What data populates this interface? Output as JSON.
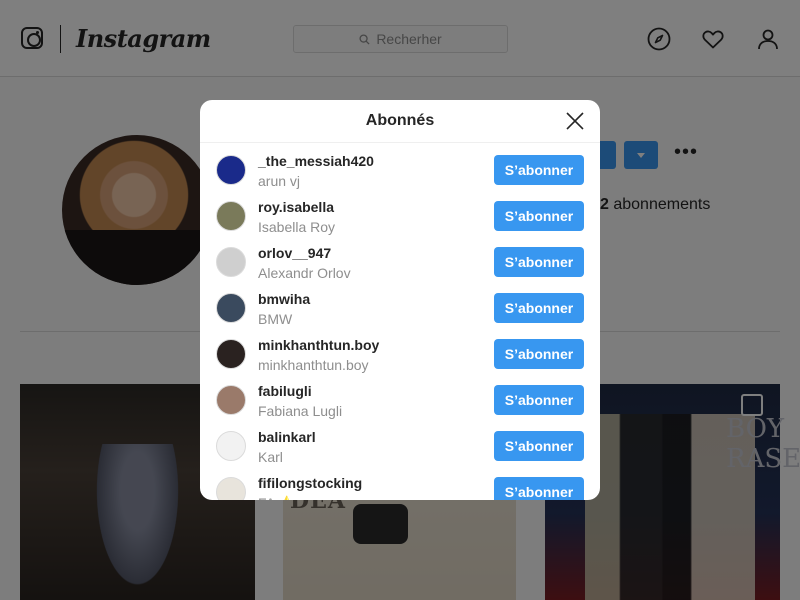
{
  "app": {
    "wordmark": "Instagram",
    "search_placeholder": "Recherher"
  },
  "profile": {
    "following_count": "2",
    "following_label": " abonnements"
  },
  "background": {
    "post_2_text": "DEA",
    "post_3_text": "BOY\nRASE"
  },
  "modal": {
    "title": "Abonnés",
    "close_icon": "close-icon",
    "followers": [
      {
        "username": "_the_messiah420",
        "full_name": "arun vj",
        "button": "S’abonner",
        "avatar_color": "#1a2a8a"
      },
      {
        "username": "roy.isabella",
        "full_name": "Isabella Roy",
        "button": "S’abonner",
        "avatar_color": "#7a7a5a"
      },
      {
        "username": "orlov__947",
        "full_name": "Alexandr Orlov",
        "button": "S’abonner",
        "avatar_color": "#cfcfcf"
      },
      {
        "username": "bmwiha",
        "full_name": "BMW",
        "button": "S’abonner",
        "avatar_color": "#3a4a5e"
      },
      {
        "username": "minkhanthtun.boy",
        "full_name": "minkhanthtun.boy",
        "button": "S’abonner",
        "avatar_color": "#2a2220"
      },
      {
        "username": "fabilugli",
        "full_name": "Fabiana Lugli",
        "button": "S’abonner",
        "avatar_color": "#9a7a6a"
      },
      {
        "username": "balinkarl",
        "full_name": "Karl",
        "button": "S’abonner",
        "avatar_color": "#f2f2f2"
      },
      {
        "username": "fifilongstocking",
        "full_name": "FA ⭐",
        "button": "S’abonner",
        "avatar_color": "#e8e4dc"
      }
    ]
  },
  "colors": {
    "accent": "#3897f0",
    "text_primary": "#262626",
    "text_secondary": "#8e8e8e"
  }
}
